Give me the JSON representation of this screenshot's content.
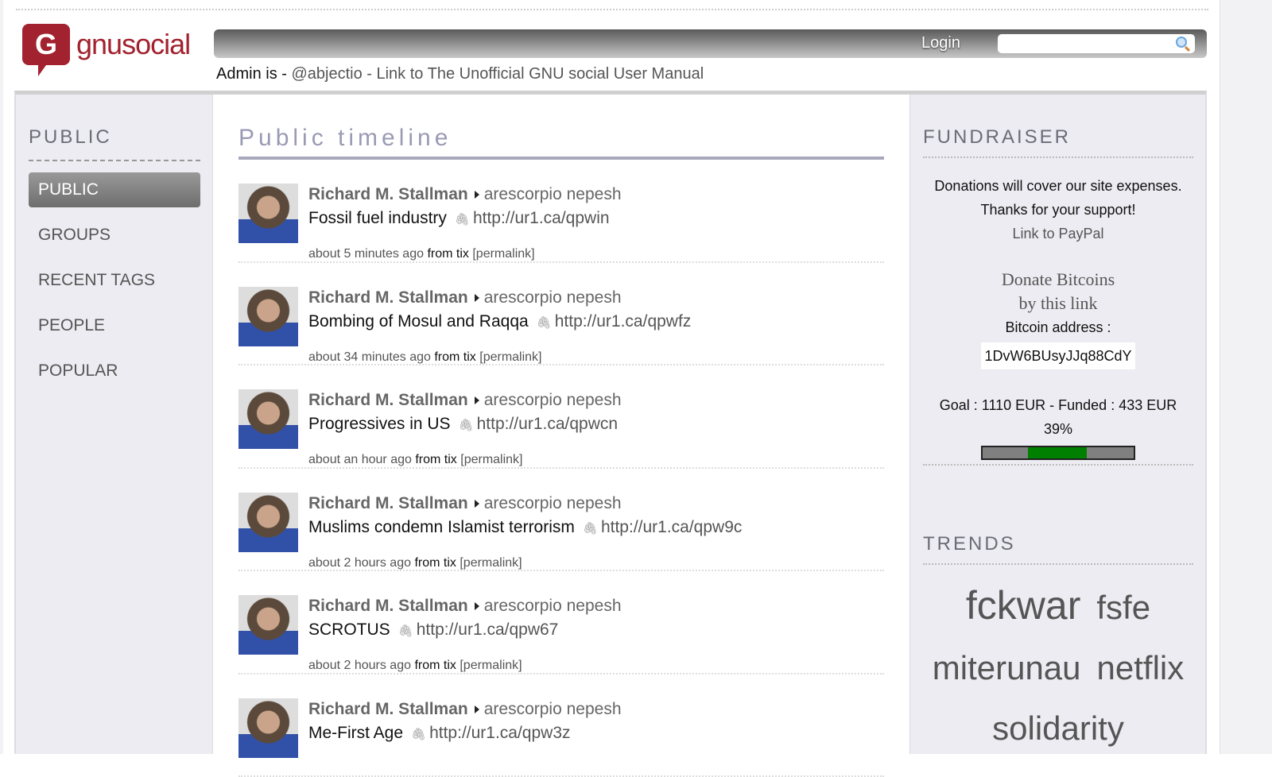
{
  "header": {
    "logo_icon": "G",
    "logo_text": "gnusocial",
    "login": "Login",
    "search_placeholder": "",
    "admin_prefix": "Admin is - ",
    "admin_link": "@abjectio - Link to The Unofficial GNU social User Manual"
  },
  "sidebar": {
    "heading": "PUBLIC",
    "items": [
      {
        "label": "PUBLIC",
        "active": true
      },
      {
        "label": "GROUPS"
      },
      {
        "label": "RECENT TAGS"
      },
      {
        "label": "PEOPLE"
      },
      {
        "label": "POPULAR"
      }
    ]
  },
  "main": {
    "title": "Public timeline",
    "notices": [
      {
        "author": "Richard M. Stallman",
        "recipient": "arescorpio nepesh",
        "text": "Fossil fuel industry",
        "link": "http://ur1.ca/qpwin",
        "time": "about 5 minutes ago",
        "from": "from tix",
        "permalink": "[permalink]"
      },
      {
        "author": "Richard M. Stallman",
        "recipient": "arescorpio nepesh",
        "text": "Bombing of Mosul and Raqqa",
        "link": "http://ur1.ca/qpwfz",
        "time": "about 34 minutes ago",
        "from": "from tix",
        "permalink": "[permalink]"
      },
      {
        "author": "Richard M. Stallman",
        "recipient": "arescorpio nepesh",
        "text": "Progressives in US",
        "link": "http://ur1.ca/qpwcn",
        "time": "about an hour ago",
        "from": "from tix",
        "permalink": "[permalink]"
      },
      {
        "author": "Richard M. Stallman",
        "recipient": "arescorpio nepesh",
        "text": "Muslims condemn Islamist terrorism",
        "link": "http://ur1.ca/qpw9c",
        "time": "about 2 hours ago",
        "from": "from tix",
        "permalink": "[permalink]"
      },
      {
        "author": "Richard M. Stallman",
        "recipient": "arescorpio nepesh",
        "text": "SCROTUS",
        "link": "http://ur1.ca/qpw67",
        "time": "about 2 hours ago",
        "from": "from tix",
        "permalink": "[permalink]"
      },
      {
        "author": "Richard M. Stallman",
        "recipient": "arescorpio nepesh",
        "text": "Me-First Age",
        "link": "http://ur1.ca/qpw3z",
        "time": "",
        "from": "",
        "permalink": ""
      }
    ]
  },
  "fundraiser": {
    "heading": "FUNDRAISER",
    "line1": "Donations will cover our site expenses.",
    "line2": "Thanks for your support!",
    "paypal": "Link to PayPal",
    "btc1": "Donate Bitcoins",
    "btc2": "by this link",
    "btc_label": "Bitcoin address :",
    "btc_address": "1DvW6BUsyJJq88CdY",
    "goal": "Goal : 1110 EUR - Funded : 433 EUR",
    "percent_text": "39%",
    "percent": 39,
    "colors": {
      "fill": "#008000",
      "track": "#808080"
    }
  },
  "trends": {
    "heading": "TRENDS",
    "tags": [
      "fckwar",
      "fsfe",
      "miterunau",
      "netflix",
      "solidarity"
    ]
  }
}
